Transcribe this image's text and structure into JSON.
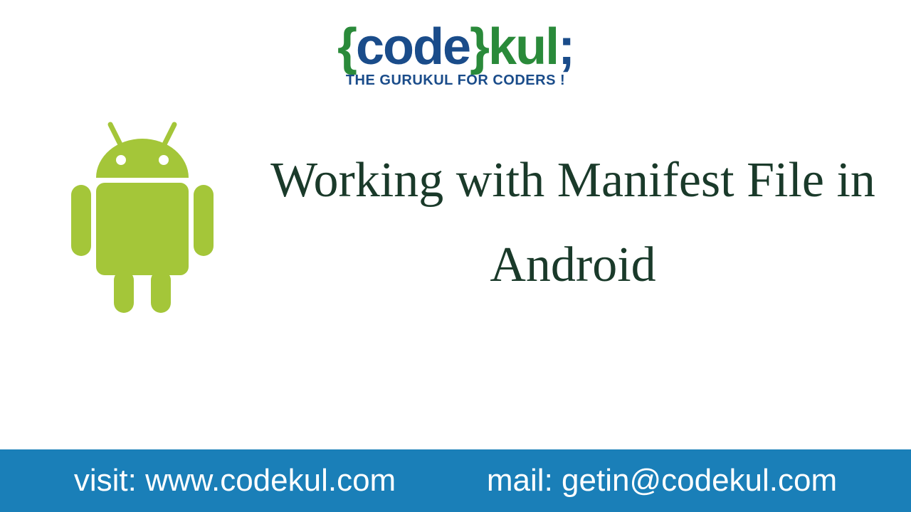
{
  "logo": {
    "brace_open": "{",
    "code": "code",
    "brace_close": "}",
    "kul": "kul",
    "semi": ";"
  },
  "tagline": "The Gurukul For Coders !",
  "title": "Working with Manifest File in Android",
  "footer": {
    "visit_label": "visit:",
    "visit_value": "www.codekul.com",
    "mail_label": "mail:",
    "mail_value": "getin@codekul.com"
  }
}
